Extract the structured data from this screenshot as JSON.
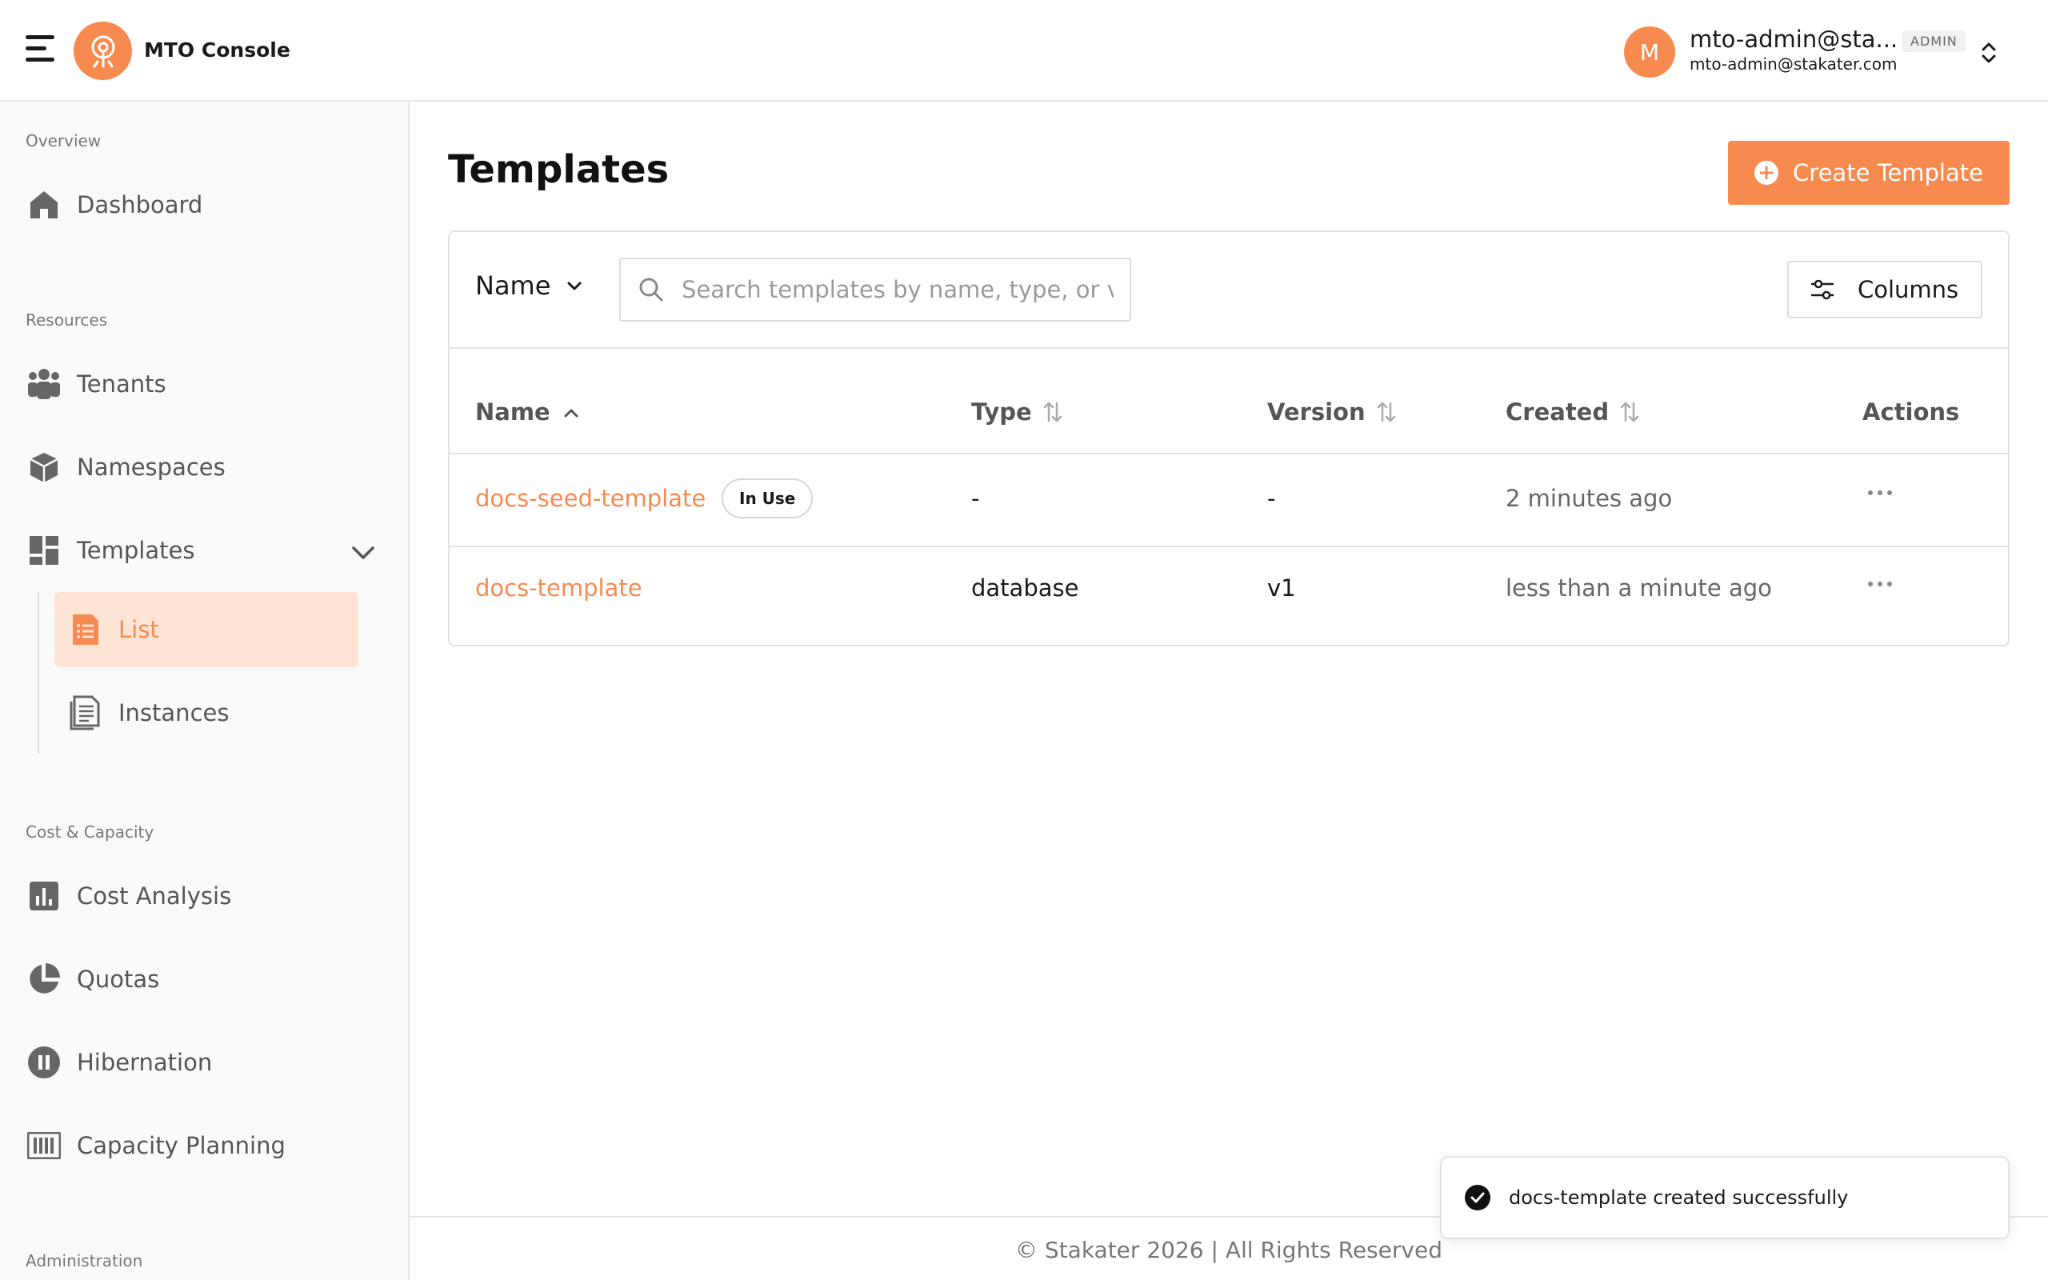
{
  "header": {
    "app_title": "MTO Console",
    "user": {
      "initial": "M",
      "name": "mto-admin@sta...",
      "role": "ADMIN",
      "email": "mto-admin@stakater.com"
    }
  },
  "sidebar": {
    "sections": [
      {
        "label": "Overview"
      },
      {
        "label": "Resources"
      },
      {
        "label": "Cost & Capacity"
      },
      {
        "label": "Administration"
      }
    ],
    "items": {
      "dashboard": "Dashboard",
      "tenants": "Tenants",
      "namespaces": "Namespaces",
      "templates": "Templates",
      "templates_list": "List",
      "templates_instances": "Instances",
      "cost_analysis": "Cost Analysis",
      "quotas": "Quotas",
      "hibernation": "Hibernation",
      "capacity_planning": "Capacity Planning"
    }
  },
  "main": {
    "title": "Templates",
    "create_button": "Create Template",
    "filter": {
      "field": "Name",
      "search_placeholder": "Search templates by name, type, or version",
      "columns_button": "Columns"
    },
    "table": {
      "headers": {
        "name": "Name",
        "type": "Type",
        "version": "Version",
        "created": "Created",
        "actions": "Actions"
      },
      "rows": [
        {
          "name": "docs-seed-template",
          "badge": "In Use",
          "type": "-",
          "version": "-",
          "created": "2 minutes ago"
        },
        {
          "name": "docs-template",
          "type": "database",
          "version": "v1",
          "created": "less than a minute ago"
        }
      ]
    }
  },
  "footer": {
    "text": "© Stakater 2026 | All Rights Reserved"
  },
  "toast": {
    "message": "docs-template created successfully"
  },
  "colors": {
    "accent": "#f78a4f",
    "accent_light": "#fde4d5",
    "text_muted": "#666666"
  }
}
